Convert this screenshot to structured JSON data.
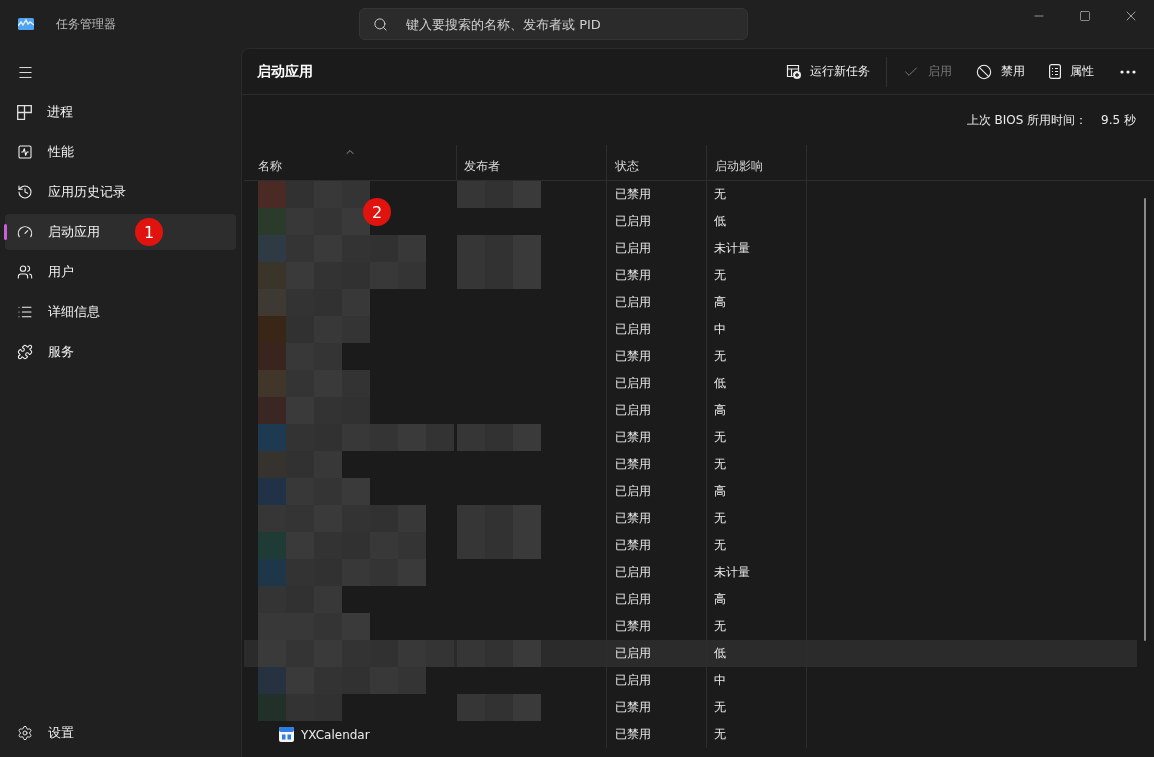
{
  "window": {
    "title": "任务管理器",
    "search": {
      "placeholder": "键入要搜索的名称、发布者或 PID"
    }
  },
  "sidebar": {
    "items": [
      {
        "label": "进程",
        "kind": "processes",
        "selected": false
      },
      {
        "label": "性能",
        "kind": "performance",
        "selected": false
      },
      {
        "label": "应用历史记录",
        "kind": "history",
        "selected": false
      },
      {
        "label": "启动应用",
        "kind": "startup",
        "selected": true
      },
      {
        "label": "用户",
        "kind": "users",
        "selected": false
      },
      {
        "label": "详细信息",
        "kind": "details",
        "selected": false
      },
      {
        "label": "服务",
        "kind": "services",
        "selected": false
      }
    ],
    "settings": {
      "label": "设置"
    }
  },
  "page": {
    "title": "启动应用",
    "actions": [
      {
        "label": "运行新任务",
        "kind": "run",
        "disabled": false
      },
      {
        "label": "启用",
        "kind": "enable",
        "disabled": true
      },
      {
        "label": "禁用",
        "kind": "disable",
        "disabled": false
      },
      {
        "label": "属性",
        "kind": "properties",
        "disabled": false
      }
    ],
    "bios": {
      "label": "上次 BIOS 所用时间：",
      "value": "9.5 秒"
    }
  },
  "table": {
    "columns": [
      {
        "label": "名称",
        "sorted": true
      },
      {
        "label": "发布者",
        "sorted": false
      },
      {
        "label": "状态",
        "sorted": false
      },
      {
        "label": "启动影响",
        "sorted": false
      }
    ],
    "rows": [
      {
        "kind": "pixelated",
        "publisher_pixelated": true,
        "status": "已禁用",
        "impact": "无",
        "selected": false
      },
      {
        "kind": "pixelated",
        "publisher_pixelated": false,
        "status": "已启用",
        "impact": "低",
        "selected": false
      },
      {
        "kind": "pixelated",
        "publisher_pixelated": true,
        "status": "已启用",
        "impact": "未计量",
        "selected": false
      },
      {
        "kind": "pixelated",
        "publisher_pixelated": true,
        "status": "已禁用",
        "impact": "无",
        "selected": false
      },
      {
        "kind": "pixelated",
        "publisher_pixelated": false,
        "status": "已启用",
        "impact": "高",
        "selected": false
      },
      {
        "kind": "pixelated",
        "publisher_pixelated": false,
        "status": "已启用",
        "impact": "中",
        "selected": false
      },
      {
        "kind": "pixelated",
        "publisher_pixelated": false,
        "status": "已禁用",
        "impact": "无",
        "selected": false
      },
      {
        "kind": "pixelated",
        "publisher_pixelated": false,
        "status": "已启用",
        "impact": "低",
        "selected": false
      },
      {
        "kind": "pixelated",
        "publisher_pixelated": false,
        "status": "已启用",
        "impact": "高",
        "selected": false
      },
      {
        "kind": "pixelated",
        "publisher_pixelated": true,
        "status": "已禁用",
        "impact": "无",
        "selected": false
      },
      {
        "kind": "pixelated",
        "publisher_pixelated": false,
        "status": "已禁用",
        "impact": "无",
        "selected": false
      },
      {
        "kind": "pixelated",
        "publisher_pixelated": false,
        "status": "已启用",
        "impact": "高",
        "selected": false
      },
      {
        "kind": "pixelated",
        "publisher_pixelated": true,
        "status": "已禁用",
        "impact": "无",
        "selected": false
      },
      {
        "kind": "pixelated",
        "publisher_pixelated": true,
        "status": "已禁用",
        "impact": "无",
        "selected": false
      },
      {
        "kind": "pixelated",
        "publisher_pixelated": false,
        "status": "已启用",
        "impact": "未计量",
        "selected": false
      },
      {
        "kind": "pixelated",
        "publisher_pixelated": false,
        "status": "已启用",
        "impact": "高",
        "selected": false
      },
      {
        "kind": "pixelated",
        "publisher_pixelated": false,
        "status": "已禁用",
        "impact": "无",
        "selected": false
      },
      {
        "kind": "pixelated",
        "publisher_pixelated": true,
        "status": "已启用",
        "impact": "低",
        "selected": true
      },
      {
        "kind": "pixelated",
        "publisher_pixelated": false,
        "status": "已启用",
        "impact": "中",
        "selected": false
      },
      {
        "kind": "pixelated",
        "publisher_pixelated": true,
        "status": "已禁用",
        "impact": "无",
        "selected": false
      },
      {
        "kind": "app",
        "name": "YXCalendar",
        "status": "已禁用",
        "impact": "无",
        "selected": false
      }
    ]
  },
  "annotations": [
    {
      "label": "1"
    },
    {
      "label": "2"
    }
  ]
}
